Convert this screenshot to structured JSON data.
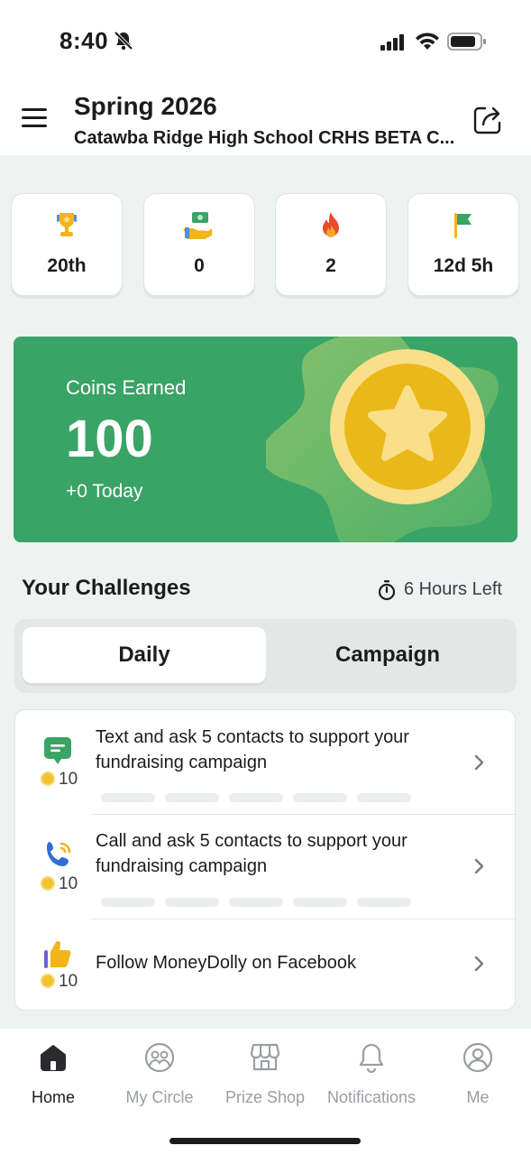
{
  "status_bar": {
    "time": "8:40"
  },
  "header": {
    "title": "Spring 2026",
    "subtitle": "Catawba Ridge High School CRHS BETA C..."
  },
  "stats": [
    {
      "icon": "trophy-icon",
      "value": "20th"
    },
    {
      "icon": "hand-money-icon",
      "value": "0"
    },
    {
      "icon": "flame-icon",
      "value": "2"
    },
    {
      "icon": "flag-icon",
      "value": "12d 5h"
    }
  ],
  "coins": {
    "label": "Coins Earned",
    "value": "100",
    "today": "+0 Today"
  },
  "challenges": {
    "title": "Your Challenges",
    "time_left": "6 Hours Left",
    "tabs": {
      "daily": "Daily",
      "campaign": "Campaign",
      "selected": "Daily"
    },
    "items": [
      {
        "icon": "chat-message-icon",
        "coins": "10",
        "text": "Text and ask 5 contacts to support your fundraising campaign",
        "progress_segments": 5,
        "progress_done": 0
      },
      {
        "icon": "phone-call-icon",
        "coins": "10",
        "text": "Call and ask 5 contacts to support your fundraising campaign",
        "progress_segments": 5,
        "progress_done": 0
      },
      {
        "icon": "thumbs-up-icon",
        "coins": "10",
        "text": "Follow MoneyDolly on Facebook"
      }
    ]
  },
  "tabbar": {
    "items": [
      {
        "label": "Home",
        "icon": "home-icon",
        "active": true
      },
      {
        "label": "My Circle",
        "icon": "circle-people-icon",
        "active": false
      },
      {
        "label": "Prize Shop",
        "icon": "shop-icon",
        "active": false
      },
      {
        "label": "Notifications",
        "icon": "bell-icon",
        "active": false
      },
      {
        "label": "Me",
        "icon": "person-icon",
        "active": false
      }
    ]
  },
  "colors": {
    "accent_green": "#3aa366",
    "coin_gold": "#f2c230",
    "background": "#eef3f1"
  }
}
